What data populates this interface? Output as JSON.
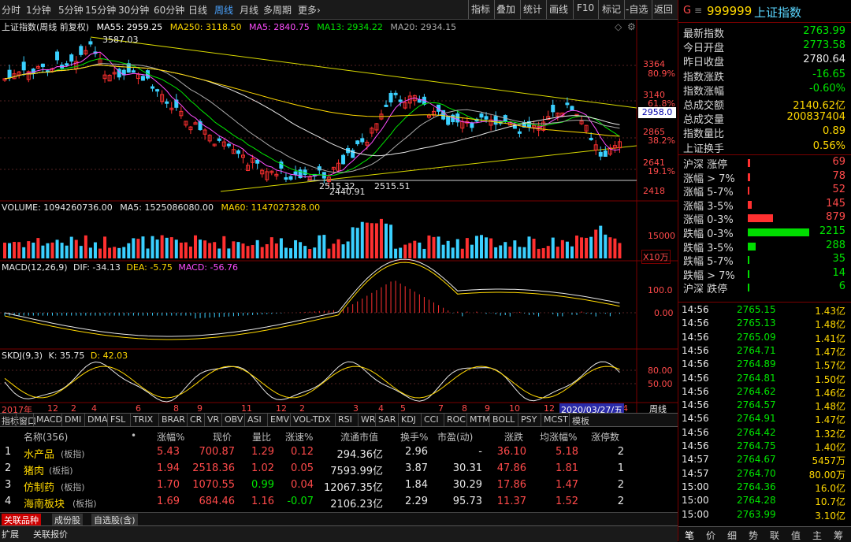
{
  "toolbar": {
    "periods": [
      "分时",
      "1分钟",
      "5分钟",
      "15分钟",
      "30分钟",
      "60分钟",
      "日线",
      "周线",
      "月线",
      "多周期",
      "更多›"
    ],
    "active_period": "周线",
    "buttons": [
      "指标",
      "叠加",
      "统计",
      "画线",
      "F10",
      "标记",
      "-自选",
      "返回"
    ]
  },
  "main_chart": {
    "title": "上证指数(周线 前复权)",
    "ma55": "MA55: 2959.25",
    "ma250": "MA250: 3118.50",
    "ma5": "MA5: 2840.75",
    "ma13": "MA13: 2934.22",
    "ma20": "MA20: 2934.15",
    "high_label": "3587.03",
    "low_labels": [
      "2515.32",
      "2440.91",
      "2515.51"
    ],
    "price_ticks": [
      "3364",
      "3140",
      "2865",
      "2641",
      "2418"
    ],
    "pct_ticks": [
      "80.9%",
      "61.8%",
      "38.2%",
      "19.1%"
    ],
    "current_price_tag": "2958.0"
  },
  "volume_panel": {
    "volume": "VOLUME: 1094260736.00",
    "ma5": "MA5: 1525086080.00",
    "ma60": "MA60: 1147027328.00",
    "tick": "15000",
    "unit": "X10万"
  },
  "macd_panel": {
    "label": "MACD(12,26,9)",
    "dif": "DIF: -34.13",
    "dea": "DEA: -5.75",
    "macd": "MACD: -56.76",
    "ticks": [
      "100.0",
      "0.00"
    ]
  },
  "skdj_panel": {
    "label": "SKDJ(9,3)",
    "k": "K: 35.75",
    "d": "D: 42.03",
    "ticks": [
      "80.00",
      "50.00"
    ]
  },
  "time_axis": {
    "labels": [
      "2017年",
      "12",
      "2",
      "4",
      "6",
      "8",
      "9",
      "11",
      "12",
      "2",
      "3",
      "4",
      "5",
      "7",
      "8",
      "9",
      "10",
      "12",
      "4"
    ],
    "highlight": "2020/03/27/五",
    "right_label": "周线"
  },
  "indicator_tabs": [
    "指标",
    "窗口",
    "MACD",
    "DMI",
    "DMA",
    "FSL",
    "TRIX",
    "BRAR",
    "CR",
    "VR",
    "OBV",
    "ASI",
    "EMV",
    "VOL-TDX",
    "RSI",
    "WR",
    "SAR",
    "KDJ",
    "CCI",
    "ROC",
    "MTM",
    "BOLL",
    "PSY",
    "MCST",
    "模板"
  ],
  "table": {
    "headers": [
      "名称(356)",
      "•",
      "涨幅%",
      "现价",
      "量比",
      "涨速%",
      "流通市值",
      "换手%",
      "市盈(动)",
      "涨跌",
      "均涨幅%",
      "涨停数"
    ],
    "rows": [
      {
        "idx": "1",
        "name": "水产品",
        "tag": "(板指)",
        "chg": "5.43",
        "price": "700.87",
        "vr": "1.29",
        "speed": "0.12",
        "cap": "294.36亿",
        "turn": "2.96",
        "pe": "-",
        "diff": "36.10",
        "avg": "5.18",
        "limit": "2"
      },
      {
        "idx": "2",
        "name": "猪肉",
        "tag": "(板指)",
        "chg": "1.94",
        "price": "2518.36",
        "vr": "1.02",
        "speed": "0.05",
        "cap": "7593.99亿",
        "turn": "3.87",
        "pe": "30.31",
        "diff": "47.86",
        "avg": "1.81",
        "limit": "1"
      },
      {
        "idx": "3",
        "name": "仿制药",
        "tag": "(板指)",
        "chg": "1.70",
        "price": "1070.55",
        "vr": "0.99",
        "speed": "0.04",
        "cap": "12067.35亿",
        "turn": "1.84",
        "pe": "30.29",
        "diff": "17.86",
        "avg": "1.47",
        "limit": "2"
      },
      {
        "idx": "4",
        "name": "海南板块",
        "tag": "(板指)",
        "chg": "1.69",
        "price": "684.46",
        "vr": "1.16",
        "speed": "-0.07",
        "cap": "2106.23亿",
        "turn": "2.29",
        "pe": "95.73",
        "diff": "11.37",
        "avg": "1.52",
        "limit": "2"
      }
    ],
    "bottom_tabs": [
      "关联品种",
      "成份股",
      "自选股(含)"
    ],
    "footer": [
      "扩展",
      "关联报价"
    ]
  },
  "quote": {
    "header_code": "999999",
    "header_name": "上证指数",
    "rows": [
      {
        "label": "最新指数",
        "value": "2763.99"
      },
      {
        "label": "今日开盘",
        "value": "2773.58"
      },
      {
        "label": "昨日收盘",
        "value": "2780.64"
      },
      {
        "label": "指数涨跌",
        "value": "-16.65"
      },
      {
        "label": "指数涨幅",
        "value": "-0.60%"
      },
      {
        "label": "总成交额",
        "value": "2140.62亿"
      },
      {
        "label": "总成交量",
        "value": "200837404"
      },
      {
        "label": "指数量比",
        "value": "0.89"
      },
      {
        "label": "上证换手",
        "value": "0.56%"
      }
    ],
    "breadth": [
      {
        "label": "沪深 涨停",
        "value": "69",
        "bar": 0.1
      },
      {
        "label": "涨幅 > 7%",
        "value": "78",
        "bar": 0.1
      },
      {
        "label": "涨幅 5-7%",
        "value": "52",
        "bar": 0.06
      },
      {
        "label": "涨幅 3-5%",
        "value": "145",
        "bar": 0.17
      },
      {
        "label": "涨幅 0-3%",
        "value": "879",
        "bar": 1.0
      },
      {
        "label": "跌幅 0-3%",
        "value": "2215",
        "bar": 1.0
      },
      {
        "label": "跌幅 3-5%",
        "value": "288",
        "bar": 0.13
      },
      {
        "label": "跌幅 5-7%",
        "value": "35",
        "bar": 0.02
      },
      {
        "label": "跌幅 > 7%",
        "value": "14",
        "bar": 0.01
      },
      {
        "label": "沪深 跌停",
        "value": "6",
        "bar": 0.01
      }
    ],
    "ticks": [
      {
        "t": "14:56",
        "p": "2765.15",
        "v": "1.43亿"
      },
      {
        "t": "14:56",
        "p": "2765.13",
        "v": "1.48亿"
      },
      {
        "t": "14:56",
        "p": "2765.09",
        "v": "1.41亿"
      },
      {
        "t": "14:56",
        "p": "2764.71",
        "v": "1.47亿"
      },
      {
        "t": "14:56",
        "p": "2764.89",
        "v": "1.57亿"
      },
      {
        "t": "14:56",
        "p": "2764.81",
        "v": "1.50亿"
      },
      {
        "t": "14:56",
        "p": "2764.62",
        "v": "1.46亿"
      },
      {
        "t": "14:56",
        "p": "2764.57",
        "v": "1.48亿"
      },
      {
        "t": "14:56",
        "p": "2764.91",
        "v": "1.47亿"
      },
      {
        "t": "14:56",
        "p": "2764.42",
        "v": "1.32亿"
      },
      {
        "t": "14:56",
        "p": "2764.75",
        "v": "1.40亿"
      },
      {
        "t": "14:57",
        "p": "2764.67",
        "v": "5457万"
      },
      {
        "t": "14:57",
        "p": "2764.70",
        "v": "80.00万"
      },
      {
        "t": "15:00",
        "p": "2764.36",
        "v": "16.0亿"
      },
      {
        "t": "15:00",
        "p": "2764.28",
        "v": "10.7亿"
      },
      {
        "t": "15:00",
        "p": "2763.99",
        "v": "3.10亿"
      }
    ],
    "bottom_tabs": [
      "笔",
      "价",
      "细",
      "势",
      "联",
      "值",
      "主",
      "筹"
    ]
  }
}
